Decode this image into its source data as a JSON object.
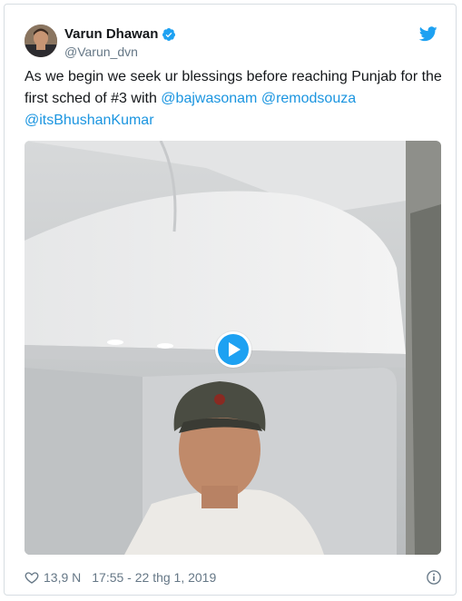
{
  "author": {
    "display_name": "Varun Dhawan",
    "handle": "@Varun_dvn"
  },
  "tweet": {
    "text_1": "As we begin we seek ur blessings before reaching Punjab for the first sched of #3 with ",
    "mention_1": "@bajwasonam",
    "space": " ",
    "mention_2": "@remodsouza",
    "mention_3": "@itsBhushanKumar"
  },
  "footer": {
    "likes": "13,9 N",
    "timestamp": "17:55 - 22 thg 1, 2019"
  },
  "icons": {
    "verified": "verified-badge-icon",
    "logo": "twitter-bird-icon",
    "play": "play-icon",
    "like": "heart-icon",
    "info": "info-icon"
  },
  "colors": {
    "link": "#1b95e0",
    "verified": "#1da1f2",
    "muted": "#657786"
  }
}
